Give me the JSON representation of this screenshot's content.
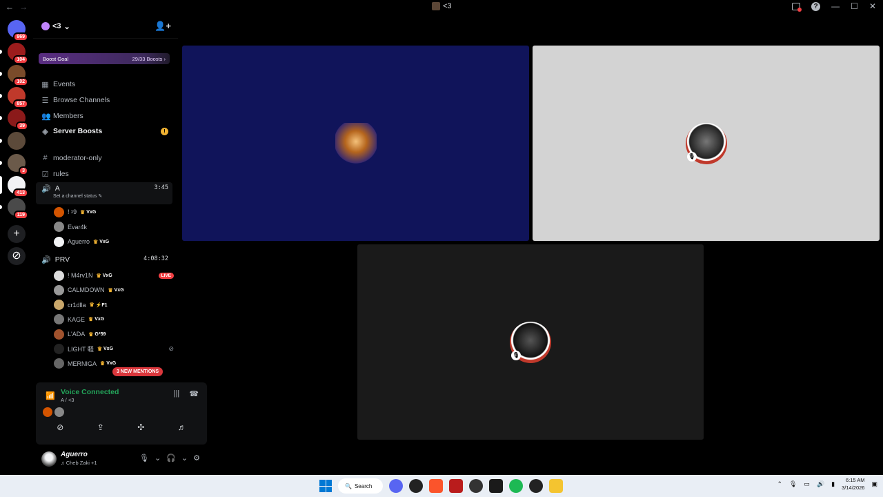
{
  "window": {
    "title": "<3",
    "back": "←",
    "forward": "→",
    "minimize": "—",
    "maximize": "☐",
    "close": "✕"
  },
  "rail": {
    "servers": [
      {
        "name": "discord-home",
        "badge": "969",
        "color": "#5865f2"
      },
      {
        "name": "server-1",
        "badge": "104",
        "color": "#9c1c1c"
      },
      {
        "name": "server-2",
        "badge": "102",
        "color": "#7a4b2a"
      },
      {
        "name": "server-3",
        "badge": "857",
        "color": "#c0392b"
      },
      {
        "name": "server-4",
        "badge": "39",
        "color": "#8b1a1a"
      },
      {
        "name": "server-5",
        "badge": "",
        "color": "#5c4a3a"
      },
      {
        "name": "server-6",
        "badge": "3",
        "color": "#6b5a4a"
      },
      {
        "name": "server-7",
        "badge": "413",
        "color": "#f2f3f5"
      },
      {
        "name": "server-8",
        "badge": "119",
        "color": "#4a4a4a"
      }
    ],
    "add": "+",
    "discover": "⊘"
  },
  "server": {
    "name": "<3",
    "chevron": "⌄",
    "invite_icon": "👤+"
  },
  "boost": {
    "label": "Boost Goal",
    "progress": "29/33 Boosts",
    "progress_value": 0.879
  },
  "nav": [
    {
      "label": "Events",
      "icon": "▦"
    },
    {
      "label": "Browse Channels",
      "icon": "☰"
    },
    {
      "label": "Members",
      "icon": "👥"
    },
    {
      "label": "Server Boosts",
      "icon": "◈",
      "warn": "!"
    }
  ],
  "channels": [
    {
      "label": "moderator-only",
      "icon": "#"
    },
    {
      "label": "rules",
      "icon": "☑"
    }
  ],
  "voice_a": {
    "name": "A",
    "timer": "3:45",
    "status": "Set a channel status ✎",
    "members": [
      {
        "name": "! ᵡ9",
        "tag": "VxG",
        "color": "#d35400"
      },
      {
        "name": "Evar4k",
        "tag": "",
        "color": "#888"
      },
      {
        "name": "Aguerro",
        "tag": "VxG",
        "color": "#f2f3f5"
      }
    ]
  },
  "voice_prv": {
    "name": "PRV",
    "timer": "4:08:32",
    "members": [
      {
        "name": "! M4rv1N",
        "tag": "VxG",
        "extra": "LIVE",
        "color": "#ddd"
      },
      {
        "name": "CALMDOWN",
        "tag": "VxG",
        "extra": "",
        "color": "#999"
      },
      {
        "name": "cr1dlla",
        "tag": "⚡F1",
        "extra": "",
        "color": "#c9a76b"
      },
      {
        "name": "KAGE",
        "tag": "VxG",
        "extra": "",
        "color": "#777"
      },
      {
        "name": "L'ADA",
        "tag": "G*59",
        "extra": "",
        "color": "#a0522d"
      },
      {
        "name": "LIGHT 軽",
        "tag": "VxG",
        "extra": "mute",
        "color": "#222"
      },
      {
        "name": "MERNIGA",
        "tag": "VxG",
        "extra": "",
        "color": "#666"
      }
    ]
  },
  "new_mentions": "3 NEW MENTIONS",
  "voice_panel": {
    "title": "Voice Connected",
    "subtitle": "A / <3"
  },
  "user": {
    "name": "Aguerro",
    "status": "♫ Cheb Zaki +1"
  },
  "stage": {
    "tiles": [
      {
        "name": "participant-1",
        "bg": "#10145a",
        "muted": false
      },
      {
        "name": "participant-2",
        "bg": "#d3d3d3",
        "muted": true
      },
      {
        "name": "participant-3",
        "bg": "#1a1a1a",
        "muted": true
      }
    ]
  },
  "taskbar": {
    "search": "Search",
    "time": "6:15 AM",
    "date": "3/14/2026",
    "discord_badge": "9+"
  }
}
